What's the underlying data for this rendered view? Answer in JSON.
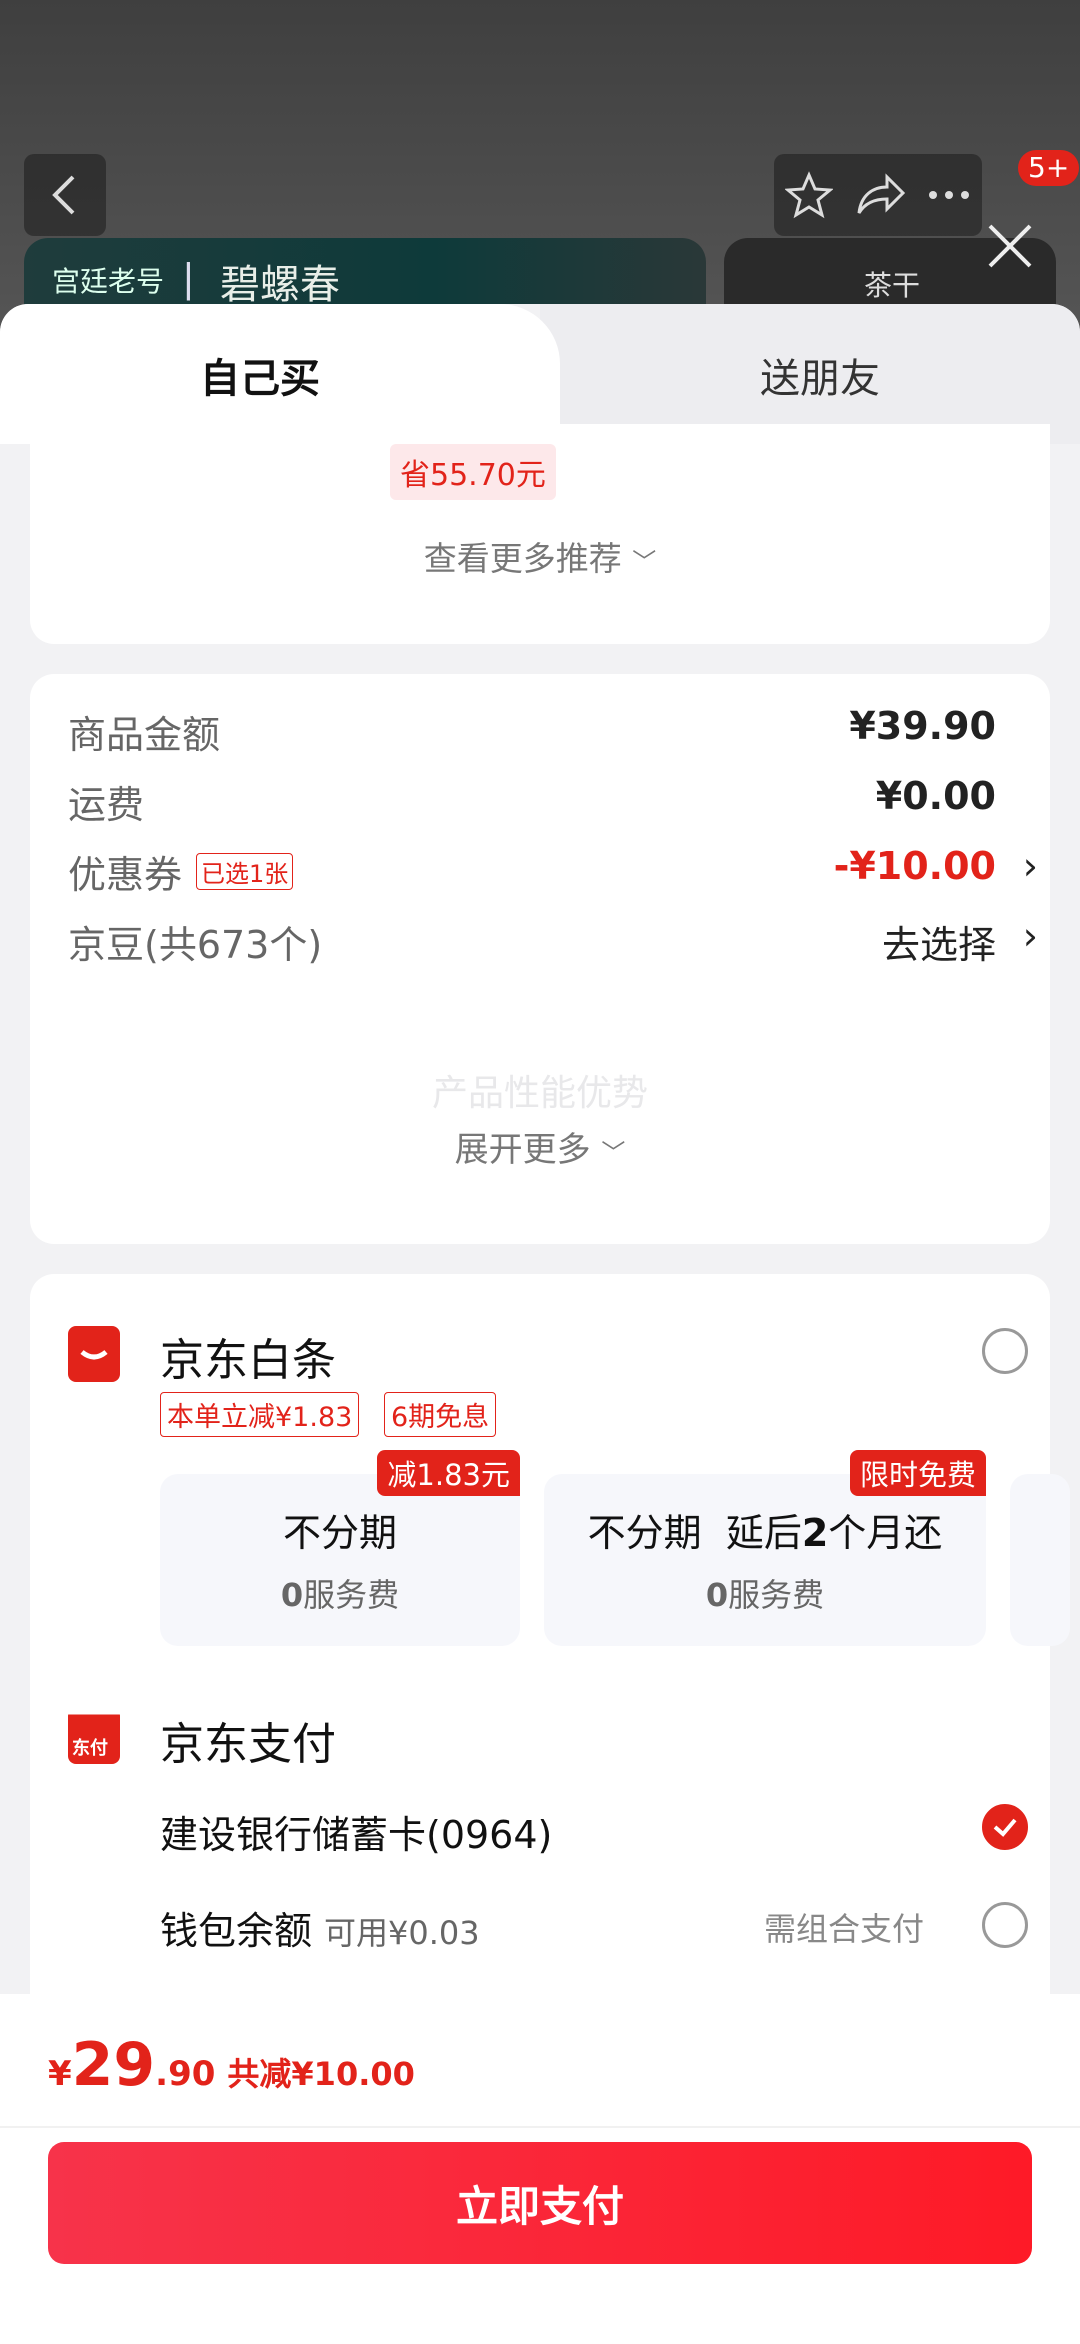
{
  "header": {
    "badge_count": "5+",
    "banner_left_logo": "宫廷老号",
    "banner_left_sep": "|",
    "banner_left_name": "碧螺春",
    "banner_right_label": "茶干"
  },
  "tabs": [
    {
      "label": "自己买",
      "active": true
    },
    {
      "label": "送朋友",
      "active": false
    }
  ],
  "recommend": {
    "save_tag": "省55.70元",
    "more_link": "查看更多推荐"
  },
  "summary": {
    "rows": [
      {
        "label": "商品金额",
        "value": "¥39.90"
      },
      {
        "label": "运费",
        "value": "¥0.00"
      },
      {
        "label": "优惠券",
        "tag": "已选1张",
        "value": "-¥10.00"
      },
      {
        "label": "京豆(共673个)",
        "value": "去选择"
      }
    ],
    "watermark": "产品性能优势",
    "expand": "展开更多"
  },
  "payment": {
    "baitiao": {
      "title": "京东白条",
      "tags": [
        "本单立减¥1.83",
        "6期免息"
      ],
      "plans": [
        {
          "badge": "减1.83元",
          "title": "不分期",
          "fee_num": "0",
          "fee_text": "服务费"
        },
        {
          "badge": "限时免费",
          "title_a": "不分期  延后",
          "title_num": "2",
          "title_b": "个月还",
          "fee_num": "0",
          "fee_text": "服务费"
        }
      ]
    },
    "jdpay": {
      "title": "京东支付",
      "icon_text": "东付",
      "card": "建设银行储蓄卡(0964)",
      "wallet_label": "钱包余额",
      "wallet_avail": "可用¥0.03",
      "wallet_note": "需组合支付"
    }
  },
  "footer": {
    "currency": "¥",
    "price_int": "29",
    "price_dec": ".90",
    "discount": "共减¥10.00",
    "pay_button": "立即支付"
  },
  "colors": {
    "accent": "#e2231a",
    "button_gradient_start": "#f7334a",
    "button_gradient_end": "#fe1a27"
  }
}
